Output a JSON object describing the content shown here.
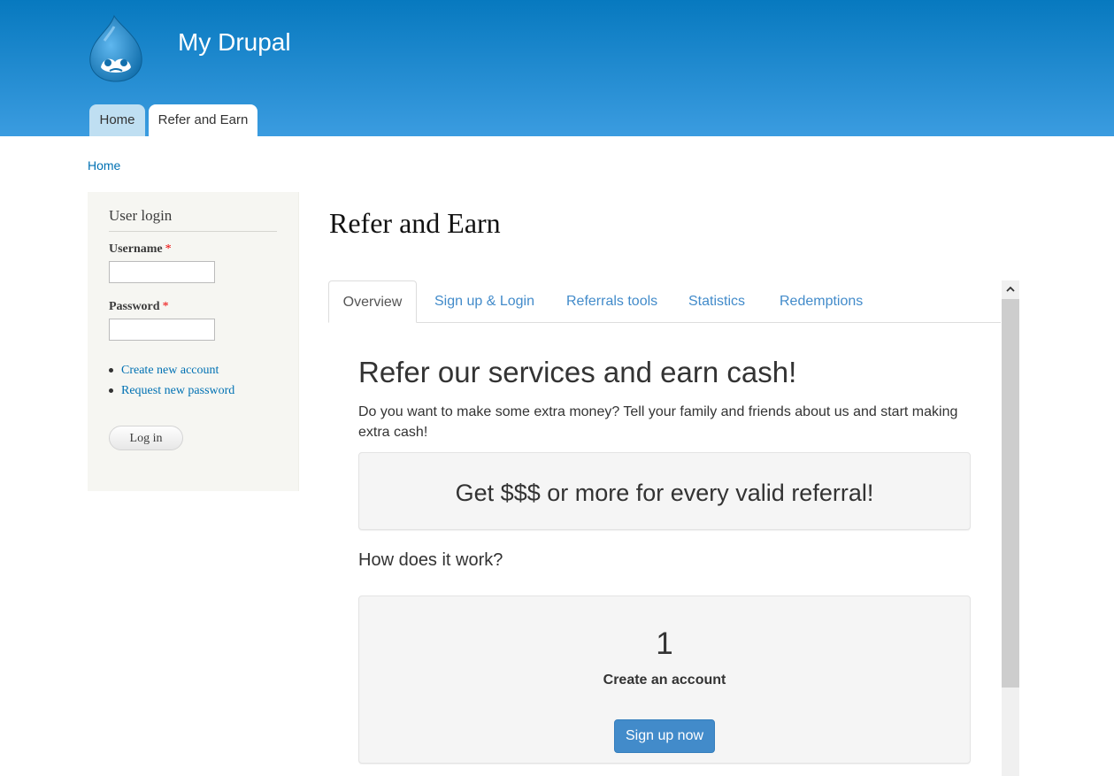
{
  "header": {
    "site_name": "My Drupal",
    "logo_icon": "drupal-drop-logo",
    "tabs": [
      {
        "label": "Home",
        "active": false
      },
      {
        "label": "Refer and Earn",
        "active": true
      }
    ]
  },
  "breadcrumb": {
    "items": [
      "Home"
    ]
  },
  "sidebar": {
    "block_title": "User login",
    "username_label": "Username",
    "password_label": "Password",
    "required_marker": "*",
    "username_value": "",
    "password_value": "",
    "links": [
      "Create new account",
      "Request new password"
    ],
    "login_button": "Log in"
  },
  "main": {
    "page_title": "Refer and Earn",
    "tabs": [
      {
        "label": "Overview",
        "active": true
      },
      {
        "label": "Sign up & Login",
        "active": false
      },
      {
        "label": "Referrals tools",
        "active": false
      },
      {
        "label": "Statistics",
        "active": false
      },
      {
        "label": "Redemptions",
        "active": false
      }
    ],
    "heading": "Refer our services and earn cash!",
    "intro": "Do you want to make some extra money? Tell your family and friends about us and start making extra cash!",
    "promo": "Get $$$ or more for every valid referral!",
    "how_heading": "How does it work?",
    "step": {
      "number": "1",
      "title": "Create an account",
      "button": "Sign up now"
    }
  },
  "colors": {
    "header_top": "#0779bf",
    "header_bottom": "#3b9ce0",
    "link": "#0071b3",
    "tab_link": "#428bca",
    "button_primary": "#428bca"
  }
}
